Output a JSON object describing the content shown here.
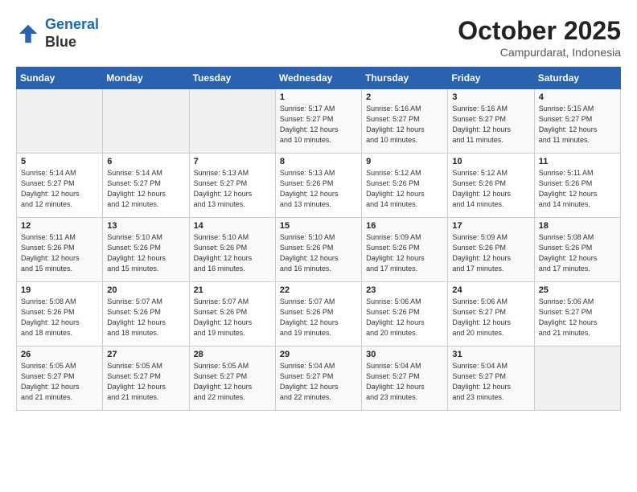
{
  "header": {
    "logo_line1": "General",
    "logo_line2": "Blue",
    "month": "October 2025",
    "location": "Campurdarat, Indonesia"
  },
  "weekdays": [
    "Sunday",
    "Monday",
    "Tuesday",
    "Wednesday",
    "Thursday",
    "Friday",
    "Saturday"
  ],
  "weeks": [
    [
      {
        "day": "",
        "info": ""
      },
      {
        "day": "",
        "info": ""
      },
      {
        "day": "",
        "info": ""
      },
      {
        "day": "1",
        "info": "Sunrise: 5:17 AM\nSunset: 5:27 PM\nDaylight: 12 hours\nand 10 minutes."
      },
      {
        "day": "2",
        "info": "Sunrise: 5:16 AM\nSunset: 5:27 PM\nDaylight: 12 hours\nand 10 minutes."
      },
      {
        "day": "3",
        "info": "Sunrise: 5:16 AM\nSunset: 5:27 PM\nDaylight: 12 hours\nand 11 minutes."
      },
      {
        "day": "4",
        "info": "Sunrise: 5:15 AM\nSunset: 5:27 PM\nDaylight: 12 hours\nand 11 minutes."
      }
    ],
    [
      {
        "day": "5",
        "info": "Sunrise: 5:14 AM\nSunset: 5:27 PM\nDaylight: 12 hours\nand 12 minutes."
      },
      {
        "day": "6",
        "info": "Sunrise: 5:14 AM\nSunset: 5:27 PM\nDaylight: 12 hours\nand 12 minutes."
      },
      {
        "day": "7",
        "info": "Sunrise: 5:13 AM\nSunset: 5:27 PM\nDaylight: 12 hours\nand 13 minutes."
      },
      {
        "day": "8",
        "info": "Sunrise: 5:13 AM\nSunset: 5:26 PM\nDaylight: 12 hours\nand 13 minutes."
      },
      {
        "day": "9",
        "info": "Sunrise: 5:12 AM\nSunset: 5:26 PM\nDaylight: 12 hours\nand 14 minutes."
      },
      {
        "day": "10",
        "info": "Sunrise: 5:12 AM\nSunset: 5:26 PM\nDaylight: 12 hours\nand 14 minutes."
      },
      {
        "day": "11",
        "info": "Sunrise: 5:11 AM\nSunset: 5:26 PM\nDaylight: 12 hours\nand 14 minutes."
      }
    ],
    [
      {
        "day": "12",
        "info": "Sunrise: 5:11 AM\nSunset: 5:26 PM\nDaylight: 12 hours\nand 15 minutes."
      },
      {
        "day": "13",
        "info": "Sunrise: 5:10 AM\nSunset: 5:26 PM\nDaylight: 12 hours\nand 15 minutes."
      },
      {
        "day": "14",
        "info": "Sunrise: 5:10 AM\nSunset: 5:26 PM\nDaylight: 12 hours\nand 16 minutes."
      },
      {
        "day": "15",
        "info": "Sunrise: 5:10 AM\nSunset: 5:26 PM\nDaylight: 12 hours\nand 16 minutes."
      },
      {
        "day": "16",
        "info": "Sunrise: 5:09 AM\nSunset: 5:26 PM\nDaylight: 12 hours\nand 17 minutes."
      },
      {
        "day": "17",
        "info": "Sunrise: 5:09 AM\nSunset: 5:26 PM\nDaylight: 12 hours\nand 17 minutes."
      },
      {
        "day": "18",
        "info": "Sunrise: 5:08 AM\nSunset: 5:26 PM\nDaylight: 12 hours\nand 17 minutes."
      }
    ],
    [
      {
        "day": "19",
        "info": "Sunrise: 5:08 AM\nSunset: 5:26 PM\nDaylight: 12 hours\nand 18 minutes."
      },
      {
        "day": "20",
        "info": "Sunrise: 5:07 AM\nSunset: 5:26 PM\nDaylight: 12 hours\nand 18 minutes."
      },
      {
        "day": "21",
        "info": "Sunrise: 5:07 AM\nSunset: 5:26 PM\nDaylight: 12 hours\nand 19 minutes."
      },
      {
        "day": "22",
        "info": "Sunrise: 5:07 AM\nSunset: 5:26 PM\nDaylight: 12 hours\nand 19 minutes."
      },
      {
        "day": "23",
        "info": "Sunrise: 5:06 AM\nSunset: 5:26 PM\nDaylight: 12 hours\nand 20 minutes."
      },
      {
        "day": "24",
        "info": "Sunrise: 5:06 AM\nSunset: 5:27 PM\nDaylight: 12 hours\nand 20 minutes."
      },
      {
        "day": "25",
        "info": "Sunrise: 5:06 AM\nSunset: 5:27 PM\nDaylight: 12 hours\nand 21 minutes."
      }
    ],
    [
      {
        "day": "26",
        "info": "Sunrise: 5:05 AM\nSunset: 5:27 PM\nDaylight: 12 hours\nand 21 minutes."
      },
      {
        "day": "27",
        "info": "Sunrise: 5:05 AM\nSunset: 5:27 PM\nDaylight: 12 hours\nand 21 minutes."
      },
      {
        "day": "28",
        "info": "Sunrise: 5:05 AM\nSunset: 5:27 PM\nDaylight: 12 hours\nand 22 minutes."
      },
      {
        "day": "29",
        "info": "Sunrise: 5:04 AM\nSunset: 5:27 PM\nDaylight: 12 hours\nand 22 minutes."
      },
      {
        "day": "30",
        "info": "Sunrise: 5:04 AM\nSunset: 5:27 PM\nDaylight: 12 hours\nand 23 minutes."
      },
      {
        "day": "31",
        "info": "Sunrise: 5:04 AM\nSunset: 5:27 PM\nDaylight: 12 hours\nand 23 minutes."
      },
      {
        "day": "",
        "info": ""
      }
    ]
  ]
}
